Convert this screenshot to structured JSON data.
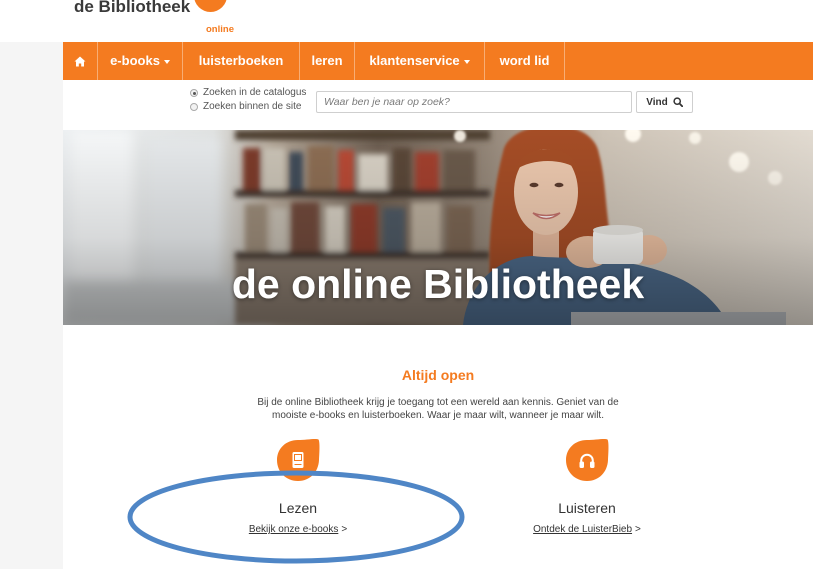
{
  "logo": {
    "name": "de Bibliotheek",
    "sub": "online"
  },
  "nav": {
    "home_icon": "home-icon",
    "items": [
      {
        "label": "e-books",
        "has_dropdown": true
      },
      {
        "label": "luisterboeken",
        "has_dropdown": false
      },
      {
        "label": "leren",
        "has_dropdown": false
      },
      {
        "label": "klantenservice",
        "has_dropdown": true
      },
      {
        "label": "word lid",
        "has_dropdown": false
      }
    ]
  },
  "search": {
    "options": [
      {
        "label": "Zoeken in de catalogus",
        "selected": true
      },
      {
        "label": "Zoeken binnen de site",
        "selected": false
      }
    ],
    "placeholder": "Waar ben je naar op zoek?",
    "button_label": "Vind",
    "button_icon": "search-icon"
  },
  "hero": {
    "title": "de online Bibliotheek"
  },
  "intro": {
    "heading": "Altijd open",
    "lines": [
      "Bij de online Bibliotheek krijg je toegang tot een wereld aan kennis. Geniet van de",
      "mooiste e-books en luisterboeken. Waar je maar wilt, wanneer je maar wilt."
    ]
  },
  "features": [
    {
      "icon": "book-icon",
      "title": "Lezen",
      "link": "Bekijk onze e-books",
      "arrow": ">"
    },
    {
      "icon": "headphones-icon",
      "title": "Luisteren",
      "link": "Ontdek de LuisterBieb",
      "arrow": ">"
    }
  ],
  "colors": {
    "brand": "#f47b20",
    "annotation": "#4f86c6"
  }
}
